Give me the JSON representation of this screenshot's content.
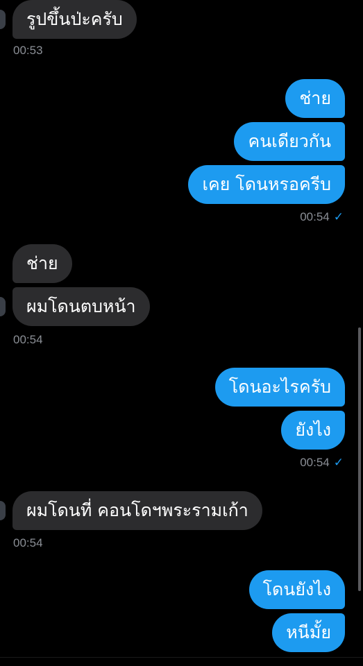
{
  "messages": [
    {
      "side": "in",
      "text": "รูปขึ้นป่ะครับ"
    },
    {
      "side": "out",
      "text": "ช่าย"
    },
    {
      "side": "out",
      "text": "คนเดียวกัน"
    },
    {
      "side": "out",
      "text": "เคย โดนหรอครีบ"
    },
    {
      "side": "in",
      "text": "ช่าย"
    },
    {
      "side": "in",
      "text": "ผมโดนตบหน้า"
    },
    {
      "side": "out",
      "text": "โดนอะไรครับ"
    },
    {
      "side": "out",
      "text": "ยังไง"
    },
    {
      "side": "in",
      "text": "ผมโดนที่ คอนโดฯพระรามเก้า"
    },
    {
      "side": "out",
      "text": "โดนยังไง"
    },
    {
      "side": "out",
      "text": "หนีมั้ย"
    }
  ],
  "timestamps": [
    {
      "side": "in",
      "text": "00:53"
    },
    {
      "side": "out",
      "text": "00:54",
      "read": "✓"
    },
    {
      "side": "in",
      "text": "00:54"
    },
    {
      "side": "out",
      "text": "00:54",
      "read": "✓"
    },
    {
      "side": "in",
      "text": "00:54"
    }
  ],
  "colors": {
    "background": "#000000",
    "incoming_bubble": "#2c2c2e",
    "outgoing_bubble": "#1d9bf0",
    "timestamp": "#8b8f96"
  },
  "icons": {
    "read_receipt": "checkmark-icon"
  }
}
